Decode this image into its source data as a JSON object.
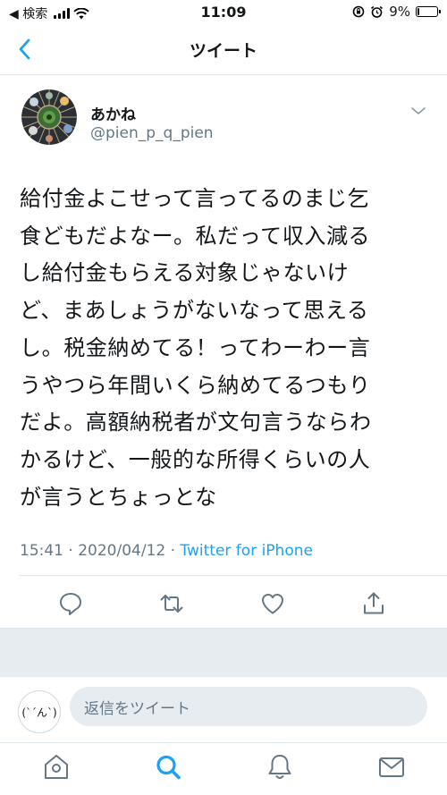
{
  "status_bar": {
    "back_app": "◀ 検索",
    "time": "11:09",
    "battery": "9%",
    "battery_level": 0.09
  },
  "nav": {
    "title": "ツイート"
  },
  "tweet": {
    "display_name": "あかね",
    "username": "@pien_p_q_pien",
    "text": "給付金よこせって言ってるのまじ乞\n食どもだよなー。私だって収入減る\nし給付金もらえる対象じゃないけ\nど、まあしょうがないなって思える\nし。税金納めてる！ってわーわー言\nうやつら年間いくら納めてるつもり\nだよ。高額納税者が文句言うならわ\nかるけど、一般的な所得くらいの人\nが言うとちょっとな",
    "time": "15:41",
    "date": "2020/04/12",
    "sep": "·",
    "via": "Twitter for iPhone"
  },
  "reply": {
    "avatar_text": "(ˋ´ん`)",
    "placeholder": "返信をツイート"
  },
  "colors": {
    "accent": "#1da1f2",
    "secondary_text": "#657786",
    "divider": "#e1e8ed",
    "band": "#e6ecf0"
  },
  "icons": {
    "back": "chevron-left-icon",
    "more": "chevron-down-icon",
    "reply": "comment-icon",
    "retweet": "retweet-icon",
    "like": "heart-icon",
    "share": "share-icon",
    "home": "home-icon",
    "search": "search-icon",
    "notifications": "bell-icon",
    "messages": "mail-icon"
  }
}
